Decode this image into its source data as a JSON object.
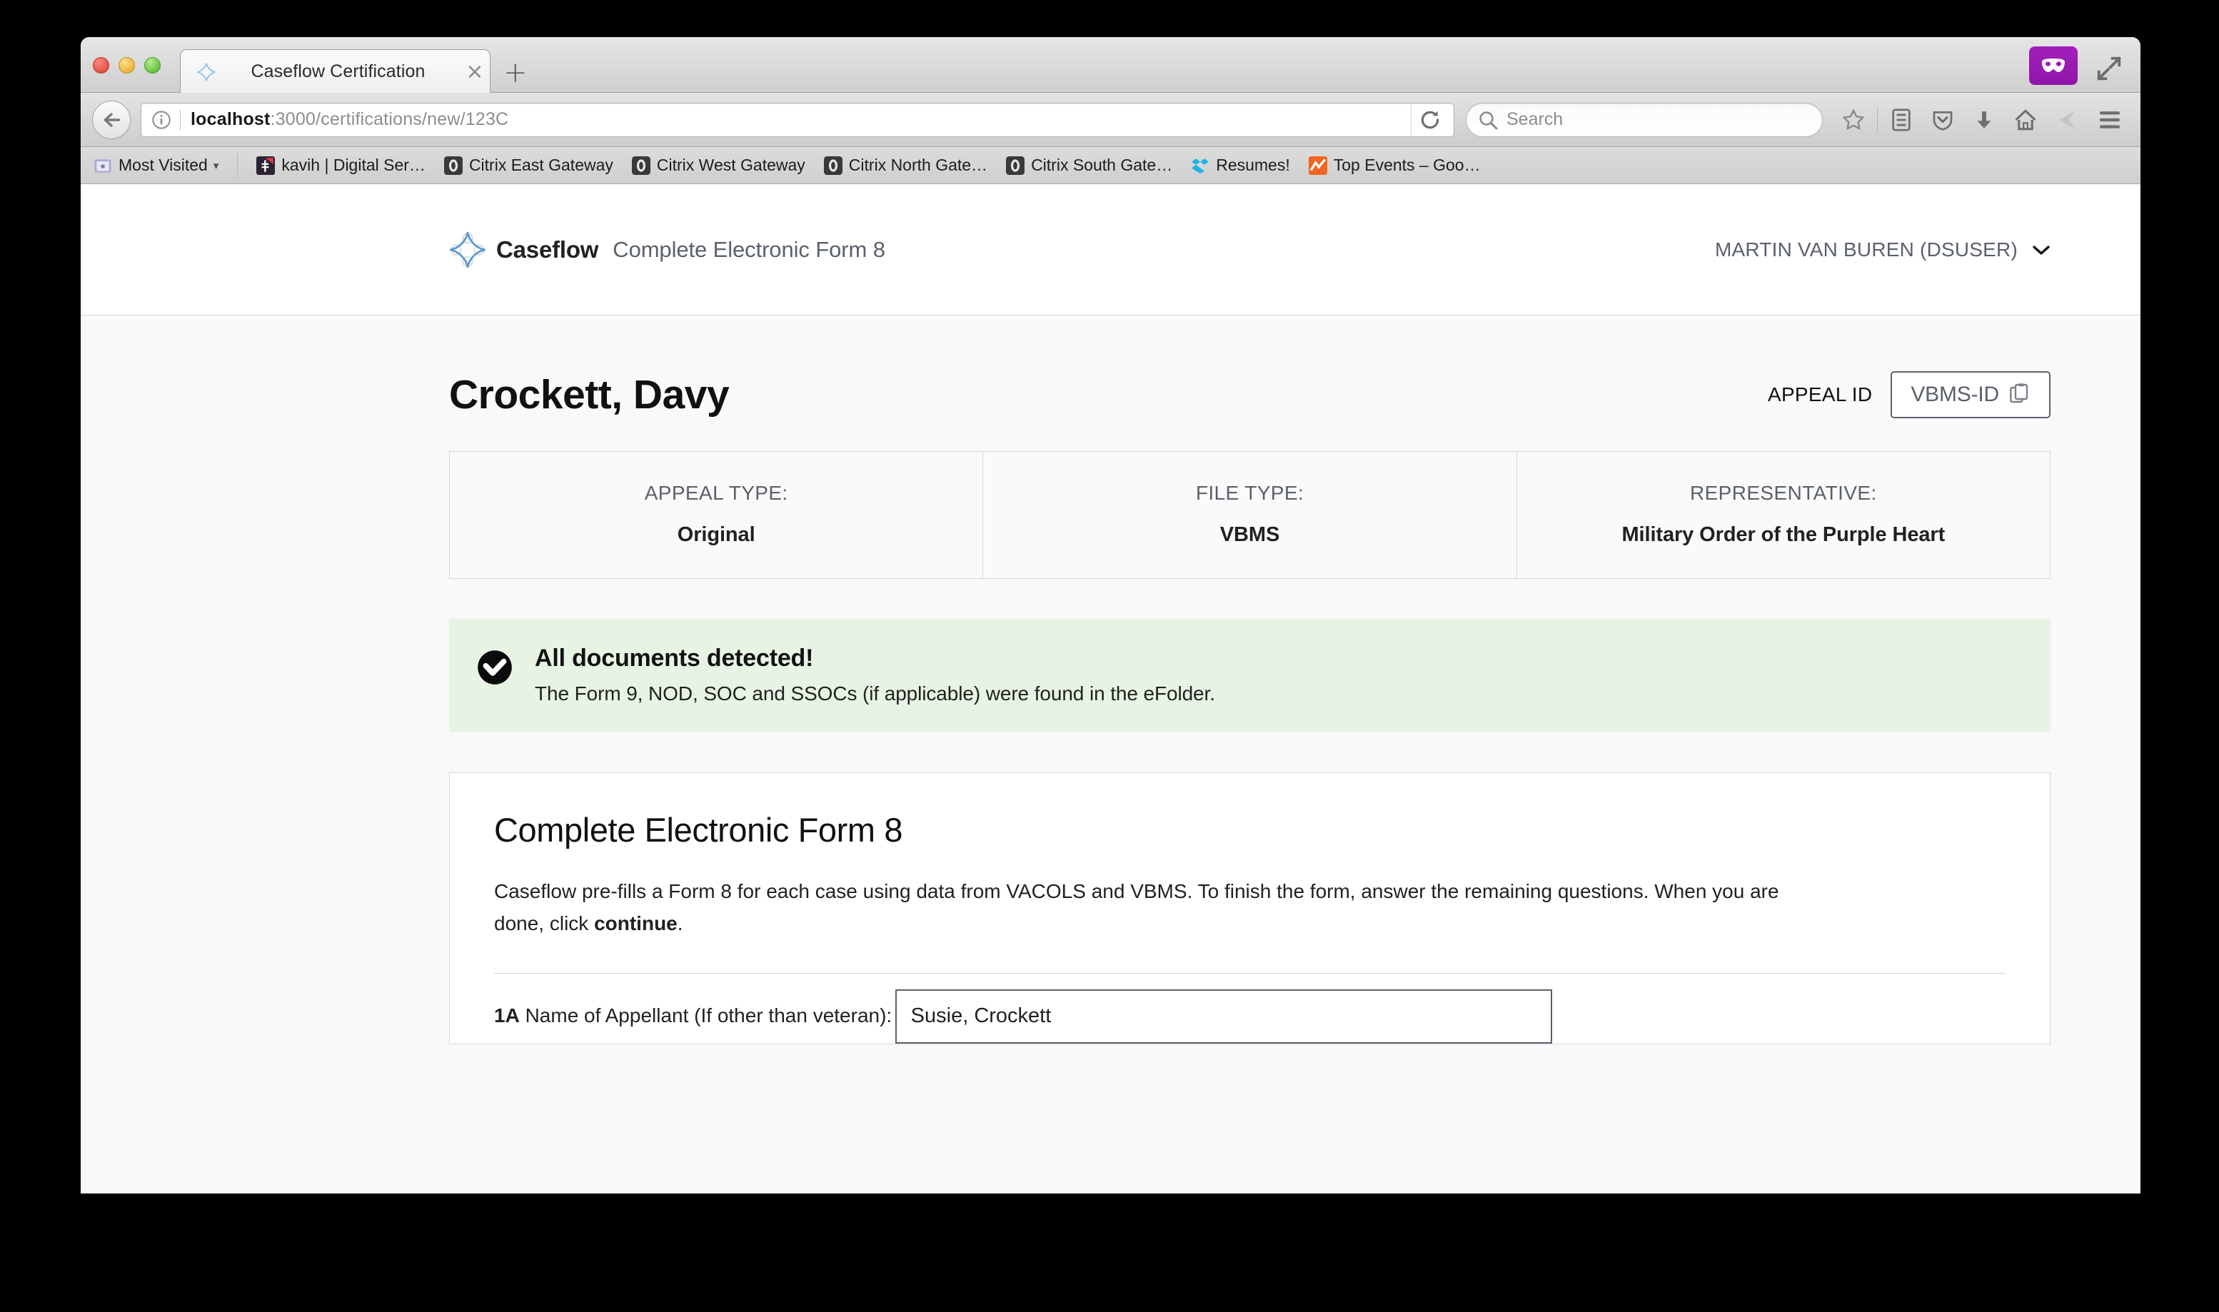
{
  "browser": {
    "tab": {
      "title": "Caseflow Certification",
      "favicon": "caseflow-star-icon",
      "close": "×"
    },
    "new_tab": "+",
    "url": {
      "host": "localhost",
      "rest": ":3000/certifications/new/123C"
    },
    "search_placeholder": "Search",
    "private_badge": "private-browsing-mask-icon",
    "bookmarks": [
      {
        "label": "Most Visited",
        "icon": "folder-icon",
        "caret": "▾"
      },
      {
        "label": "kavih | Digital Ser…",
        "icon": "github-icon"
      },
      {
        "label": "Citrix East Gateway",
        "icon": "citrix-icon"
      },
      {
        "label": "Citrix West Gateway",
        "icon": "citrix-icon"
      },
      {
        "label": "Citrix North Gate…",
        "icon": "citrix-icon"
      },
      {
        "label": "Citrix South Gate…",
        "icon": "citrix-icon"
      },
      {
        "label": "Resumes!",
        "icon": "dropbox-icon"
      },
      {
        "label": "Top Events – Goo…",
        "icon": "analytics-icon"
      }
    ],
    "toolbar_icons": [
      "star-icon",
      "reader-list-icon",
      "pocket-icon",
      "download-icon",
      "home-icon",
      "send-icon",
      "menu-icon"
    ]
  },
  "app": {
    "brand": "Caseflow",
    "subtitle": "Complete Electronic Form 8",
    "user": "MARTIN VAN BUREN (DSUSER)",
    "user_caret": "⌄"
  },
  "case": {
    "title": "Crockett, Davy",
    "appeal_id_label": "APPEAL ID",
    "vbms_id_button": "VBMS-ID",
    "info": [
      {
        "label": "APPEAL TYPE:",
        "value": "Original"
      },
      {
        "label": "FILE TYPE:",
        "value": "VBMS"
      },
      {
        "label": "REPRESENTATIVE:",
        "value": "Military Order of the Purple Heart"
      }
    ]
  },
  "alert": {
    "icon": "check-circle-icon",
    "title": "All documents detected!",
    "text": "The Form 9, NOD, SOC and SSOCs (if applicable) were found in the eFolder.",
    "background": "#e7f4e4"
  },
  "form": {
    "title": "Complete Electronic Form 8",
    "intro_part1": "Caseflow pre-fills a Form 8 for each case using data from VACOLS and VBMS. To finish the form, answer the remaining questions. When you are done, click ",
    "intro_bold": "continue",
    "intro_part2": ".",
    "field_1a_number": "1A",
    "field_1a_label": " Name of Appellant (If other than veteran):",
    "field_1a_value": "Susie, Crockett"
  },
  "colors": {
    "brand_blue": "#73b3e7",
    "alert_green": "#e7f4e4",
    "border_gray": "#d6d7d9",
    "text_gray": "#5b616b",
    "page_bg": "#f9f9f9"
  }
}
